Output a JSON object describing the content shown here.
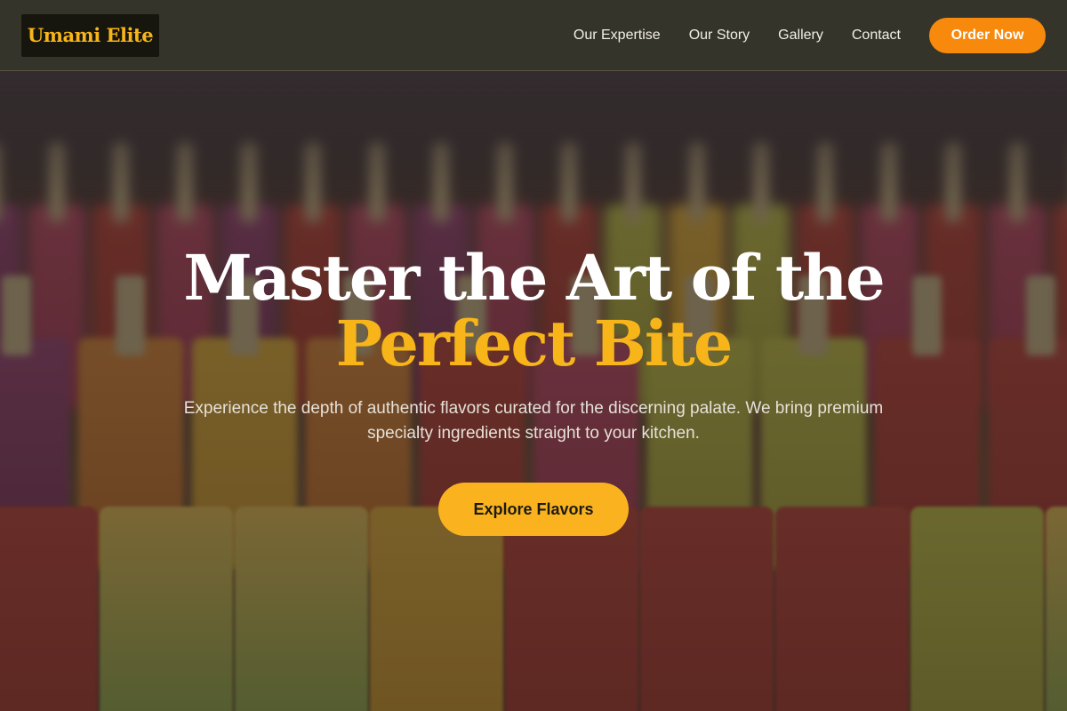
{
  "header": {
    "logo": "Umami Elite",
    "nav": [
      {
        "label": "Our Expertise"
      },
      {
        "label": "Our Story"
      },
      {
        "label": "Gallery"
      },
      {
        "label": "Contact"
      }
    ],
    "cta_label": "Order Now"
  },
  "hero": {
    "headline_line1": "Master the Art of the",
    "headline_line2": "Perfect Bite",
    "subtitle": "Experience the depth of authentic flavors curated for the discerning palate. We bring premium specialty ingredients straight to your kitchen.",
    "cta_label": "Explore Flavors"
  },
  "colors": {
    "accent": "#f7b51a",
    "order_button": "#f78a0d",
    "cta_button": "#fab31e",
    "header_bg": "#35342a"
  }
}
